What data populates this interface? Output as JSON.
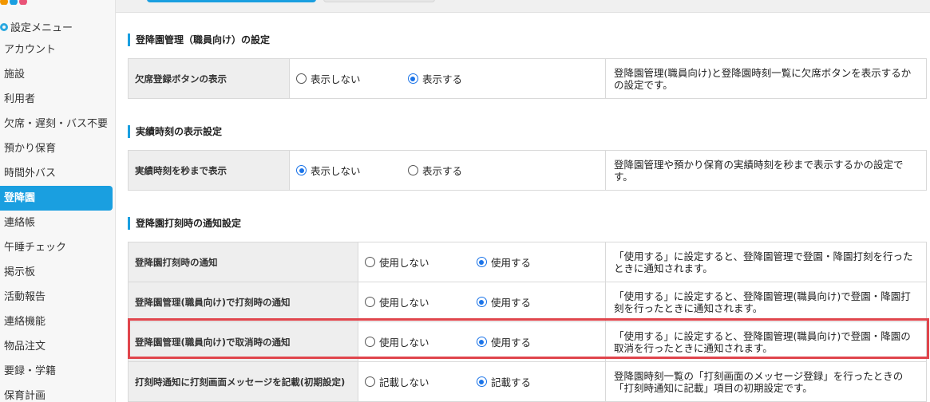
{
  "sidebar": {
    "menu_title": "設定メニュー",
    "items": [
      {
        "label": "アカウント"
      },
      {
        "label": "施設"
      },
      {
        "label": "利用者"
      },
      {
        "label": "欠席・遅刻・バス不要"
      },
      {
        "label": "預かり保育"
      },
      {
        "label": "時間外バス"
      },
      {
        "label": "登降園"
      },
      {
        "label": "連絡帳"
      },
      {
        "label": "午睡チェック"
      },
      {
        "label": "掲示板"
      },
      {
        "label": "活動報告"
      },
      {
        "label": "連絡機能"
      },
      {
        "label": "物品注文"
      },
      {
        "label": "要録・学籍"
      },
      {
        "label": "保育計画"
      }
    ],
    "active_item": "登降園"
  },
  "sections": [
    {
      "title": "登降園管理（職員向け）の設定",
      "rows": [
        {
          "label": "欠席登録ボタンの表示",
          "option1": "表示しない",
          "option2": "表示する",
          "selected": 2,
          "description": "登降園管理(職員向け)と登降園時刻一覧に欠席ボタンを表示するかの設定です。"
        }
      ]
    },
    {
      "title": "実績時刻の表示設定",
      "rows": [
        {
          "label": "実績時刻を秒まで表示",
          "option1": "表示しない",
          "option2": "表示する",
          "selected": 1,
          "description": "登降園管理や預かり保育の実績時刻を秒まで表示するかの設定です。"
        }
      ]
    },
    {
      "title": "登降園打刻時の通知設定",
      "rows": [
        {
          "label": "登降園打刻時の通知",
          "option1": "使用しない",
          "option2": "使用する",
          "selected": 2,
          "description": "「使用する」に設定すると、登降園管理で登園・降園打刻を行ったときに通知されます。"
        },
        {
          "label": "登降園管理(職員向け)で打刻時の通知",
          "option1": "使用しない",
          "option2": "使用する",
          "selected": 2,
          "description": "「使用する」に設定すると、登降園管理(職員向け)で登園・降園打刻を行ったときに通知されます。"
        },
        {
          "label": "登降園管理(職員向け)で取消時の通知",
          "option1": "使用しない",
          "option2": "使用する",
          "selected": 2,
          "description": "「使用する」に設定すると、登降園管理(職員向け)で登園・降園の取消を行ったときに通知されます。"
        },
        {
          "label": "打刻時通知に打刻画面メッセージを記載(初期設定)",
          "option1": "記載しない",
          "option2": "記載する",
          "selected": 2,
          "description": "登降園時刻一覧の「打刻画面のメッセージ登録」を行ったときの「打刻時通知に記載」項目の初期設定です。"
        }
      ]
    }
  ],
  "colors": {
    "accent": "#1a9fe0",
    "radio_selected": "#1a73e8",
    "highlight_border": "#e0454c"
  }
}
